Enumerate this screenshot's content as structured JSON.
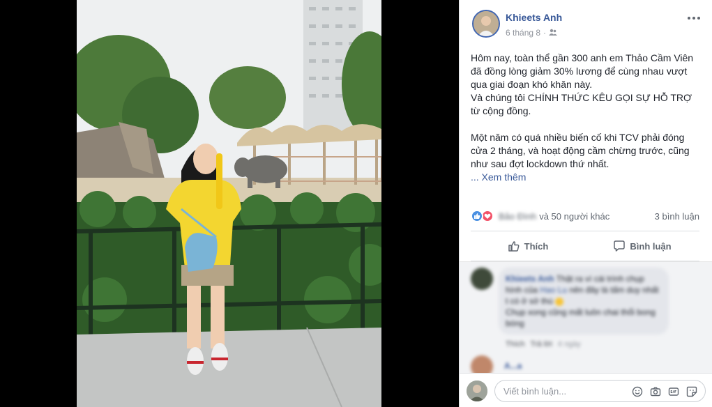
{
  "post": {
    "author": "Khieets Anh",
    "date": "6 tháng 8",
    "privacy_icon": "friends-icon",
    "lines": [
      "Hôm nay, toàn thể gần 300 anh em Thảo Cầm Viên",
      "đã đồng lòng giảm 30% lương để cùng nhau vượt",
      "qua giai đoạn khó khăn này.",
      "Và chúng tôi CHÍNH THỨC KÊU GỌI SỰ HỖ TRỢ",
      "từ cộng đồng.",
      "",
      "Một năm có quá nhiều biến cố khi TCV phải đóng",
      "cửa 2 tháng, và hoạt động cầm chừng trước, cũng",
      "như sau đợt lockdown thứ nhất."
    ],
    "see_more": "... Xem thêm"
  },
  "reactions": {
    "names_blurred": "Bảo Đình",
    "others": "và 50 người khác",
    "comment_count": "3 bình luận"
  },
  "actions": {
    "like": "Thích",
    "comment": "Bình luận"
  },
  "comments": [
    {
      "author": "Khieets Anh",
      "text_1": "Thật ra ví cái trình chụp hình",
      "text_2": "của",
      "mention": "Hao Lu",
      "text_3": "nên đây là tấm duy nhất t có ở",
      "text_4": "sở thú",
      "text_5": "Chụp xong cũng mất luôn chai thổi bong bóng",
      "like": "Thích",
      "reply": "Trả lời",
      "time": "4 ngày"
    },
    {
      "author": "A...a"
    }
  ],
  "composer": {
    "placeholder": "Viết bình luận..."
  },
  "colors": {
    "link": "#385898",
    "like_blue": "#4a90e2",
    "love_red": "#f25268",
    "muted": "#606770"
  }
}
